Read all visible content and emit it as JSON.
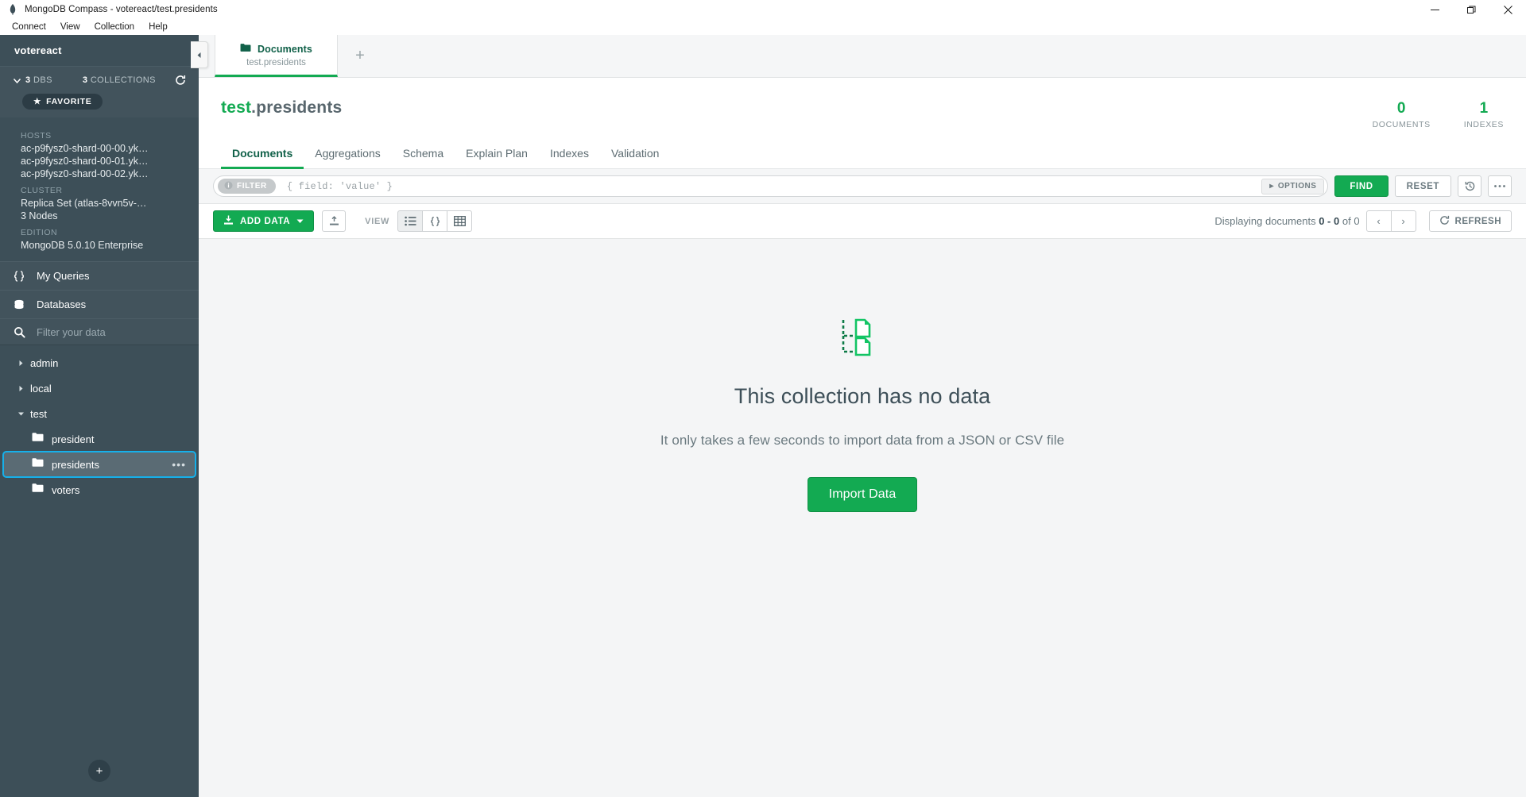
{
  "window": {
    "title": "MongoDB Compass - votereact/test.presidents",
    "app_icon": "mongodb-leaf-icon",
    "controls": {
      "minimize": "minimize-icon",
      "maximize": "maximize-icon",
      "close": "close-icon"
    }
  },
  "menubar": {
    "items": [
      "Connect",
      "View",
      "Collection",
      "Help"
    ]
  },
  "sidebar": {
    "connection_name": "votereact",
    "stats": {
      "dbs_count": "3",
      "dbs_label": "DBS",
      "collections_count": "3",
      "collections_label": "COLLECTIONS"
    },
    "favorite_label": "FAVORITE",
    "info": [
      {
        "label": "HOSTS",
        "values": [
          "ac-p9fysz0-shard-00-00.yk…",
          "ac-p9fysz0-shard-00-01.yk…",
          "ac-p9fysz0-shard-00-02.yk…"
        ]
      },
      {
        "label": "CLUSTER",
        "values": [
          "Replica Set (atlas-8vvn5v-…",
          "3 Nodes"
        ]
      },
      {
        "label": "EDITION",
        "values": [
          "MongoDB 5.0.10 Enterprise"
        ]
      }
    ],
    "nav": [
      {
        "label": "My Queries",
        "icon": "braces-icon"
      },
      {
        "label": "Databases",
        "icon": "database-icon"
      }
    ],
    "search_placeholder": "Filter your data",
    "search_value": "",
    "tree": [
      {
        "name": "admin",
        "expanded": false,
        "collections": []
      },
      {
        "name": "local",
        "expanded": false,
        "collections": []
      },
      {
        "name": "test",
        "expanded": true,
        "collections": [
          {
            "name": "president",
            "selected": false
          },
          {
            "name": "presidents",
            "selected": true
          },
          {
            "name": "voters",
            "selected": false
          }
        ]
      }
    ],
    "add_button": "+",
    "collapse_icon": "chevron-left-icon"
  },
  "tabbar": {
    "tabs": [
      {
        "title": "Documents",
        "subtitle": "test.presidents",
        "icon": "folder-icon",
        "active": true
      }
    ],
    "new_tab_label": "+"
  },
  "collection_header": {
    "database": "test",
    "separator": ".",
    "collection": "presidents",
    "stats": [
      {
        "value": "0",
        "caption": "DOCUMENTS"
      },
      {
        "value": "1",
        "caption": "INDEXES"
      }
    ]
  },
  "tabs": [
    {
      "label": "Documents",
      "active": true
    },
    {
      "label": "Aggregations",
      "active": false
    },
    {
      "label": "Schema",
      "active": false
    },
    {
      "label": "Explain Plan",
      "active": false
    },
    {
      "label": "Indexes",
      "active": false
    },
    {
      "label": "Validation",
      "active": false
    }
  ],
  "query_bar": {
    "filter_label": "FILTER",
    "filter_value": "",
    "filter_placeholder": "{ field: 'value' }",
    "options_label": "OPTIONS",
    "find_label": "FIND",
    "reset_label": "RESET",
    "history_icon": "history-icon",
    "more_icon": "ellipsis-icon"
  },
  "toolbar": {
    "add_data_label": "ADD DATA",
    "export_icon": "export-icon",
    "view_label": "VIEW",
    "view_modes": [
      {
        "name": "list-view",
        "icon": "list-icon",
        "active": true
      },
      {
        "name": "json-view",
        "icon": "braces-icon",
        "active": false
      },
      {
        "name": "table-view",
        "icon": "table-icon",
        "active": false
      }
    ],
    "displaying_prefix": "Displaying documents",
    "displaying_range": "0 - 0",
    "displaying_of": "of",
    "displaying_total": "0",
    "prev_label": "‹",
    "next_label": "›",
    "refresh_label": "REFRESH"
  },
  "empty_state": {
    "icon": "no-data-documents-icon",
    "title": "This collection has no data",
    "subtitle": "It only takes a few seconds to import data from a JSON or CSV file",
    "button_label": "Import Data"
  },
  "colors": {
    "brand_green": "#13aa52",
    "dark_green": "#116149",
    "sidebar_bg": "#3d4f58",
    "selection_outline": "#16b0ea",
    "content_bg": "#f4f5f6"
  }
}
